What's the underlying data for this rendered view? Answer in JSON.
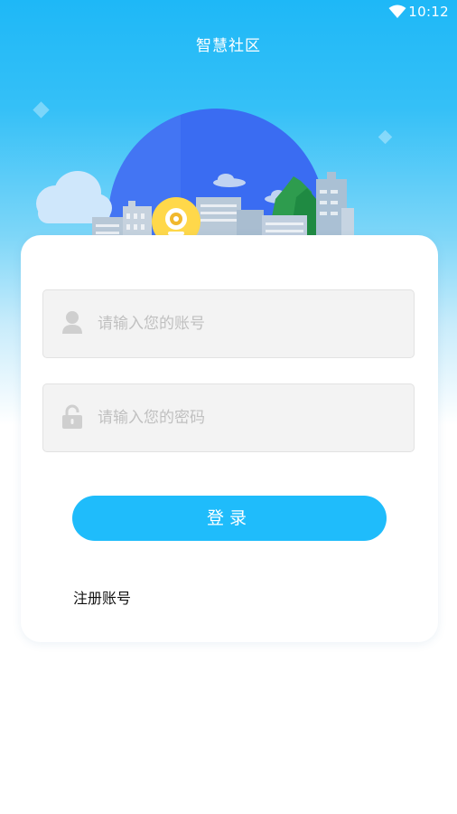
{
  "status_bar": {
    "time": "10:12",
    "wifi_icon": "wifi-icon"
  },
  "header": {
    "title": "智慧社区"
  },
  "illustration": {
    "name": "community-city-illustration",
    "colors": {
      "sky_circle": "#3d6df0",
      "building_light": "#a9c2d6",
      "tree_green": "#2e9c4e",
      "cloud": "#cfe7fb",
      "badge_yellow": "#ffd84a"
    }
  },
  "login_form": {
    "account": {
      "icon": "user-icon",
      "placeholder": "请输入您的账号",
      "value": ""
    },
    "password": {
      "icon": "lock-icon",
      "placeholder": "请输入您的密码",
      "value": ""
    },
    "login_label": "登录",
    "register_label": "注册账号"
  },
  "colors": {
    "primary": "#1fbcfb",
    "background_top": "#1eb8f7",
    "field_bg": "#f3f3f3",
    "placeholder": "#c0c0c0"
  }
}
